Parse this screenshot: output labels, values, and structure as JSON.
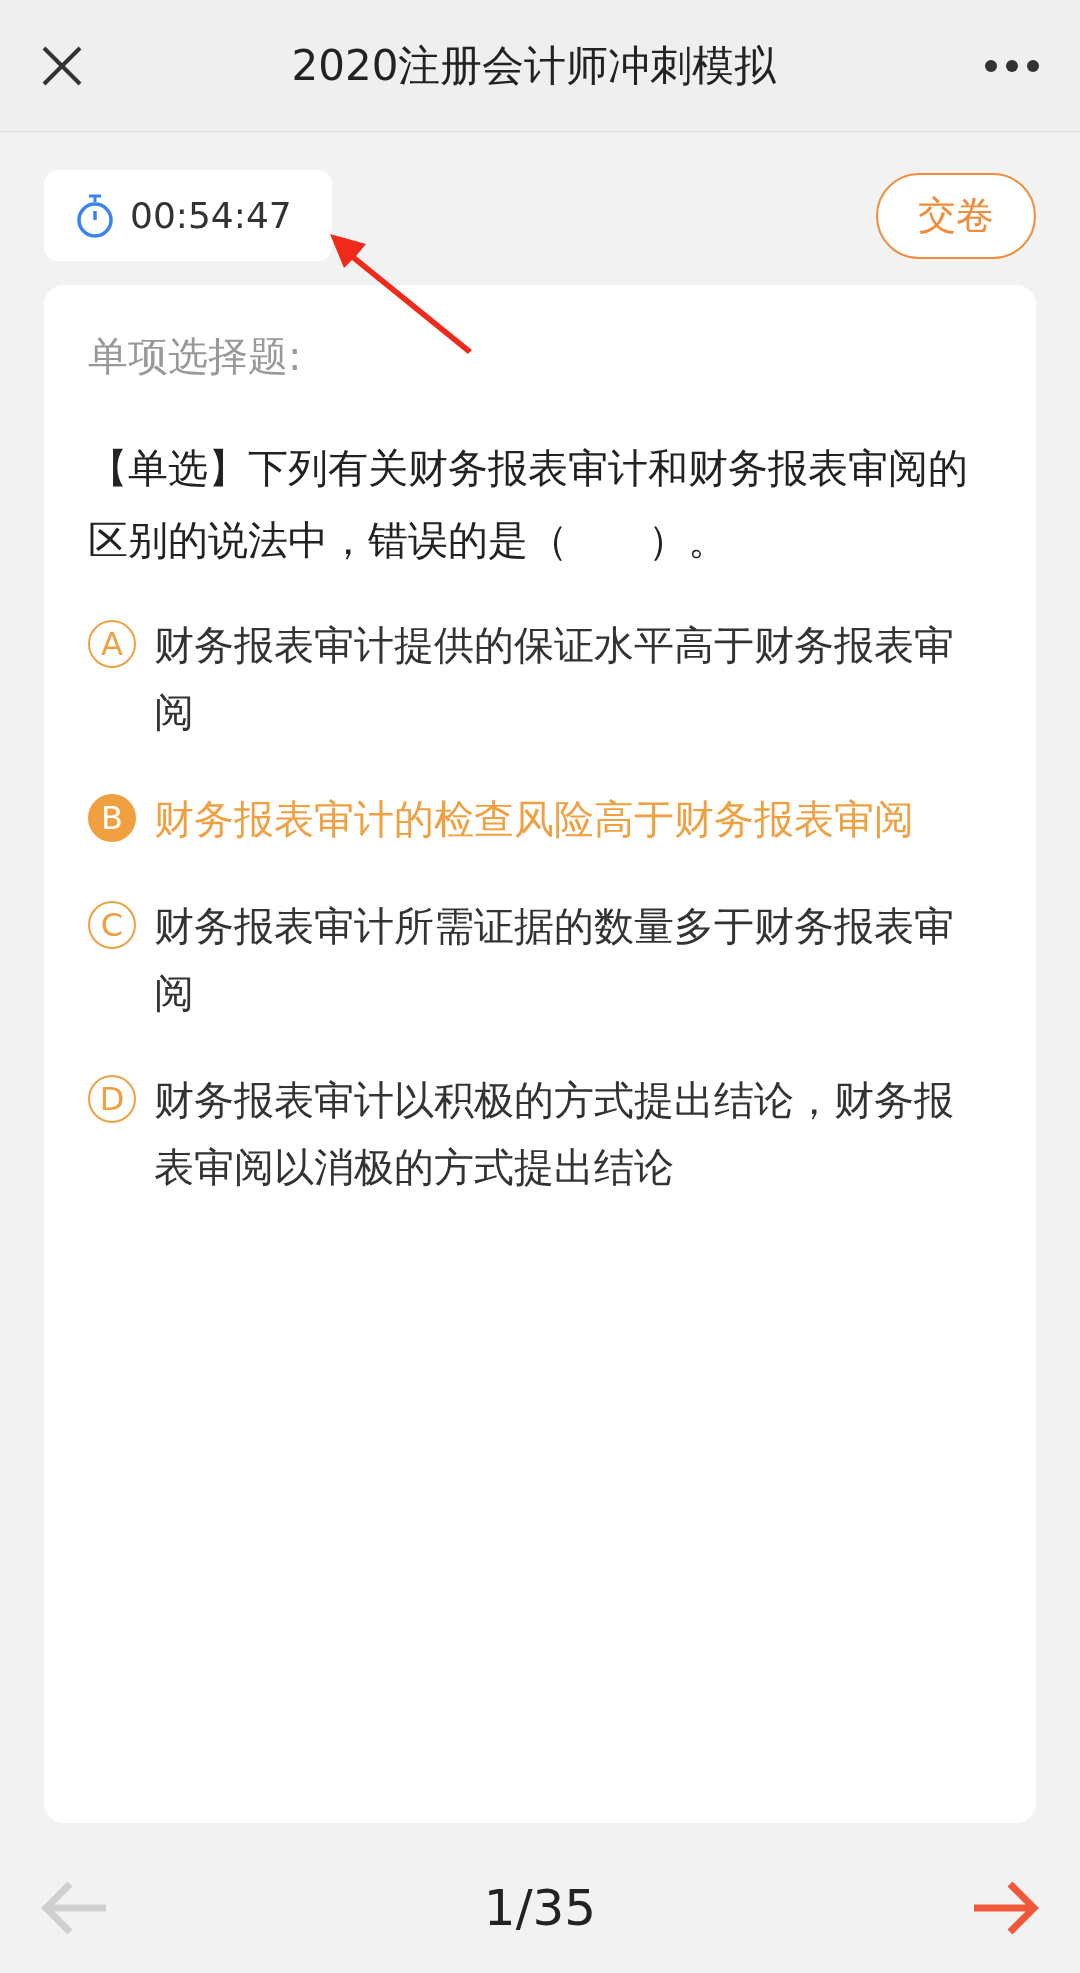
{
  "header": {
    "title": "2020注册会计师冲刺模拟"
  },
  "timer": {
    "time": "00:54:47"
  },
  "submit_button": "交卷",
  "question": {
    "type_label": "单项选择题:",
    "text": "【单选】下列有关财务报表审计和财务报表审阅的区别的说法中，错误的是（　　）。",
    "options": [
      {
        "letter": "A",
        "text": "财务报表审计提供的保证水平高于财务报表审阅",
        "selected": false
      },
      {
        "letter": "B",
        "text": "财务报表审计的检查风险高于财务报表审阅",
        "selected": true
      },
      {
        "letter": "C",
        "text": "财务报表审计所需证据的数量多于财务报表审阅",
        "selected": false
      },
      {
        "letter": "D",
        "text": "财务报表审计以积极的方式提出结论，财务报表审阅以消极的方式提出结论",
        "selected": false
      }
    ]
  },
  "footer": {
    "progress": "1/35"
  }
}
